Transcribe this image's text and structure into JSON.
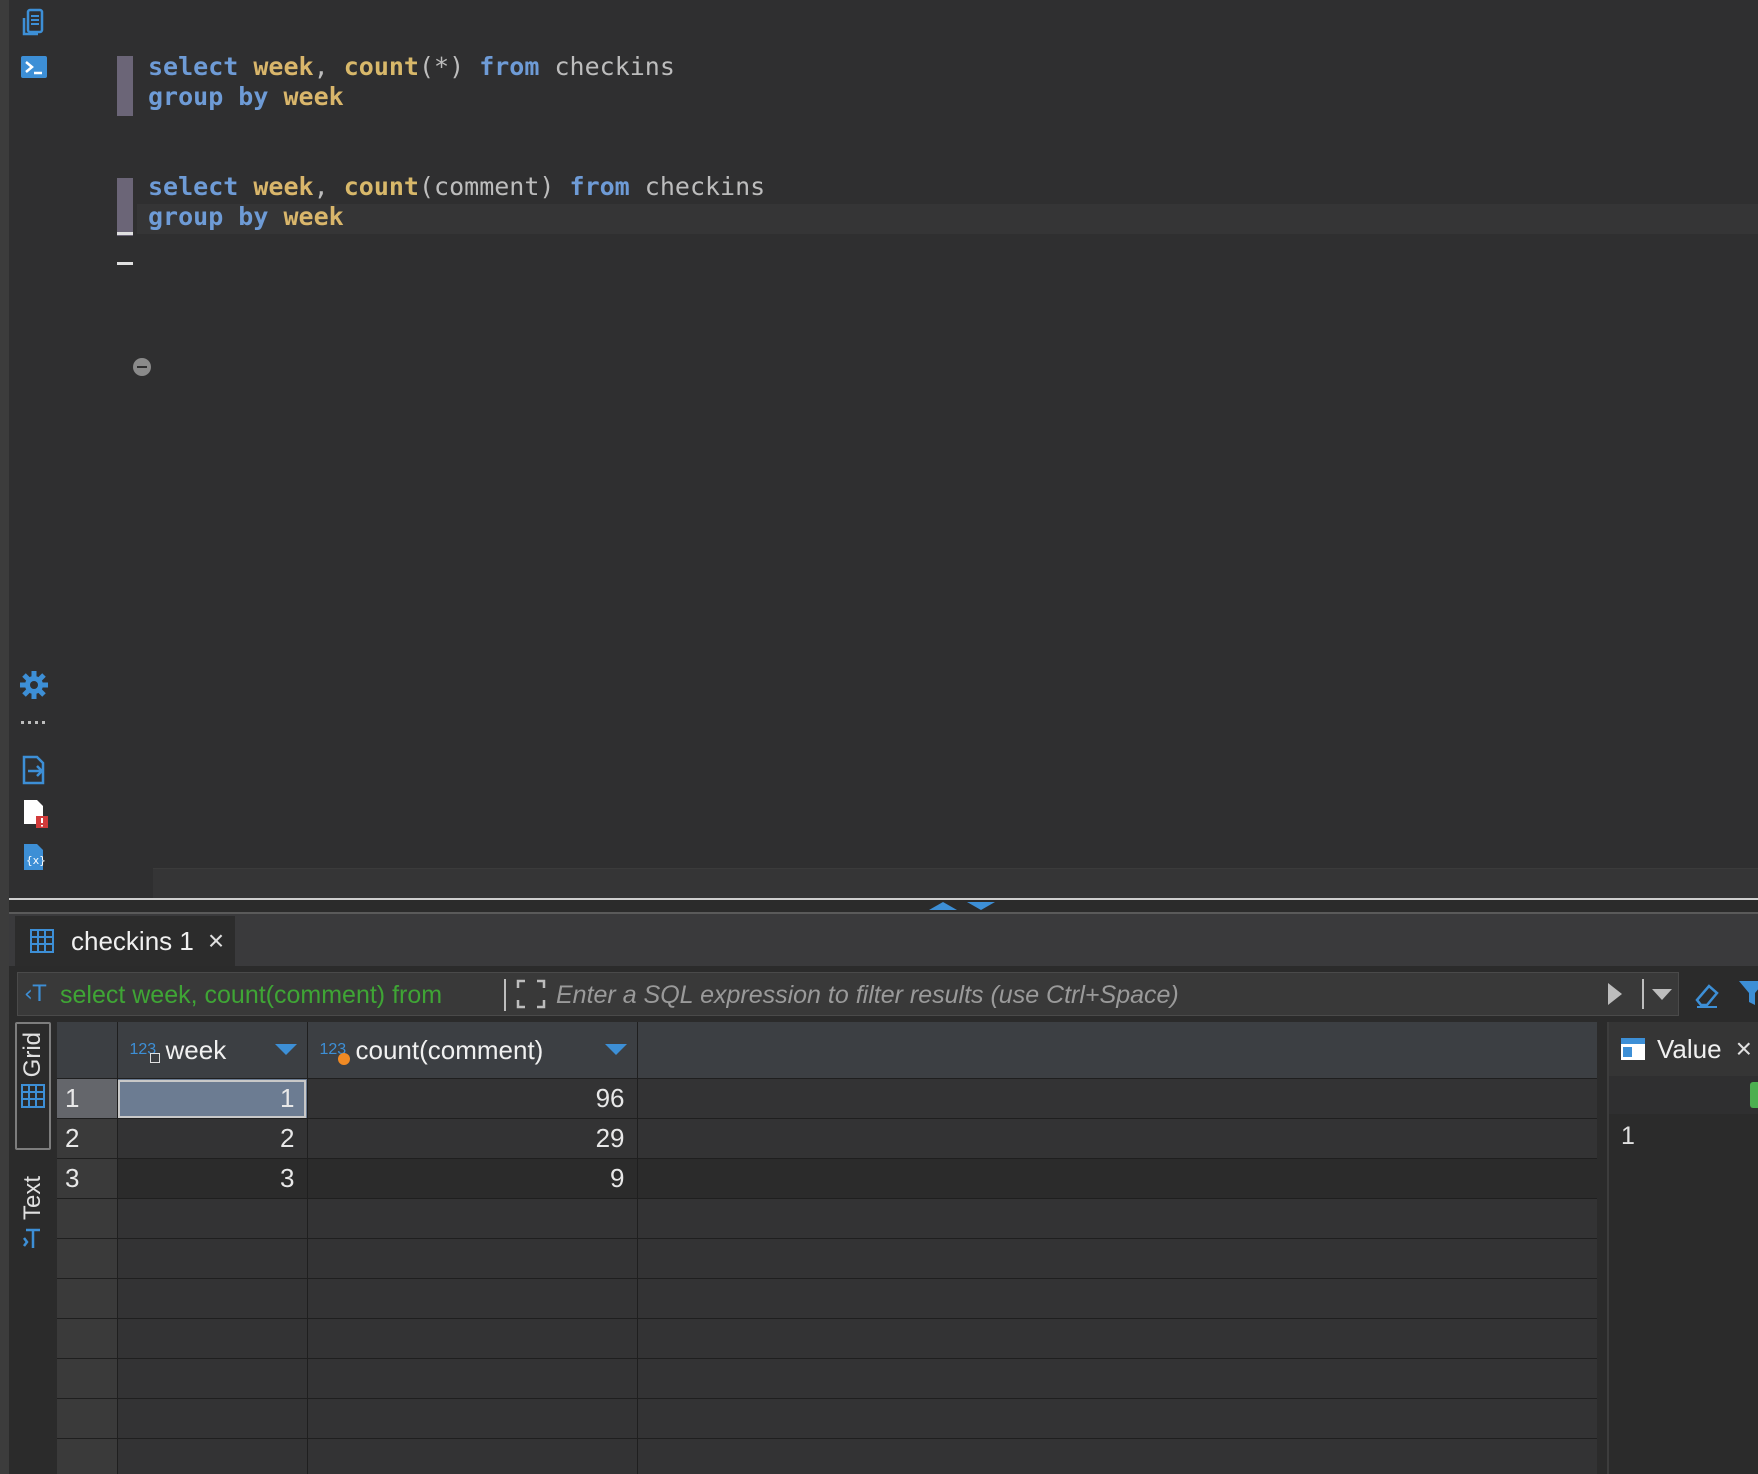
{
  "editor": {
    "queries": [
      {
        "line1": {
          "kw1": "select",
          "id1": "week",
          "comma": ",",
          "fn": "count",
          "arg": "(*)",
          "kw2": "from",
          "table": "checkins"
        },
        "line2": {
          "kw": "group by",
          "id": "week"
        }
      },
      {
        "line1": {
          "kw1": "select",
          "id1": "week",
          "comma": ",",
          "fn": "count",
          "arg": "(comment)",
          "kw2": "from",
          "table": "checkins"
        },
        "line2": {
          "kw": "group by",
          "id": "week"
        }
      }
    ]
  },
  "results": {
    "tab_label": "checkins 1",
    "filter": {
      "query_preview": "select week, count(comment) from",
      "placeholder": "Enter a SQL expression to filter results (use Ctrl+Space)"
    },
    "view_tabs": {
      "grid": "Grid",
      "text": "Text"
    },
    "columns": [
      {
        "type_badge": "123",
        "name": "week"
      },
      {
        "type_badge": "123",
        "name": "count(comment)"
      }
    ],
    "rows": [
      {
        "n": "1",
        "week": "1",
        "count": "96"
      },
      {
        "n": "2",
        "week": "2",
        "count": "29"
      },
      {
        "n": "3",
        "week": "3",
        "count": "9"
      }
    ],
    "value_panel": {
      "title": "Value",
      "content": "1"
    }
  },
  "colors": {
    "keyword": "#6e9bd6",
    "identifier": "#d9b66b",
    "accent_blue": "#3d8fd6",
    "filter_query_green": "#3fa535",
    "selected_cell": "#6c7c92"
  }
}
